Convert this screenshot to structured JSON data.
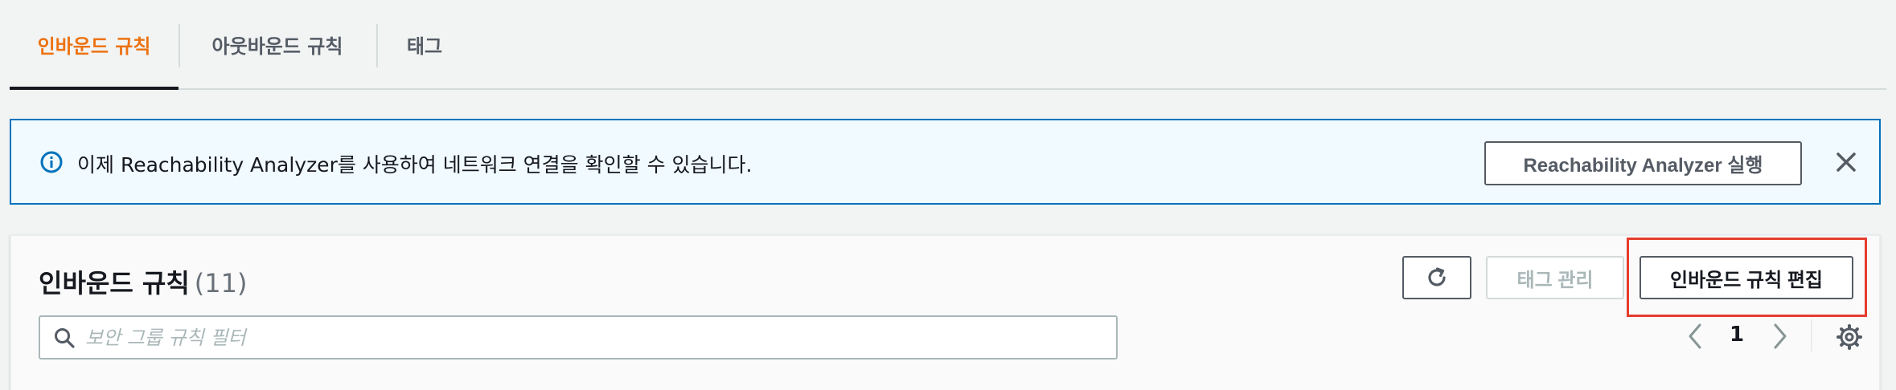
{
  "tabs": {
    "inbound": "인바운드 규칙",
    "outbound": "아웃바운드 규칙",
    "tags": "태그"
  },
  "flash": {
    "icon": "info-icon",
    "message": "이제 Reachability Analyzer를 사용하여 네트워크 연결을 확인할 수 있습니다.",
    "action_label": "Reachability Analyzer 실행",
    "close_icon": "close-icon"
  },
  "panel": {
    "title": "인바운드 규칙",
    "count": "(11)",
    "refresh_icon": "refresh-icon",
    "manage_tags_label": "태그 관리",
    "edit_label": "인바운드 규칙 편집",
    "search_placeholder": "보안 그룹 규칙 필터",
    "search_value": "",
    "page_number": "1",
    "settings_icon": "gear-icon"
  },
  "colors": {
    "accent": "#ec7211",
    "info_border": "#0073bb",
    "info_bg": "#f1faff",
    "highlight": "#e53d2e"
  }
}
